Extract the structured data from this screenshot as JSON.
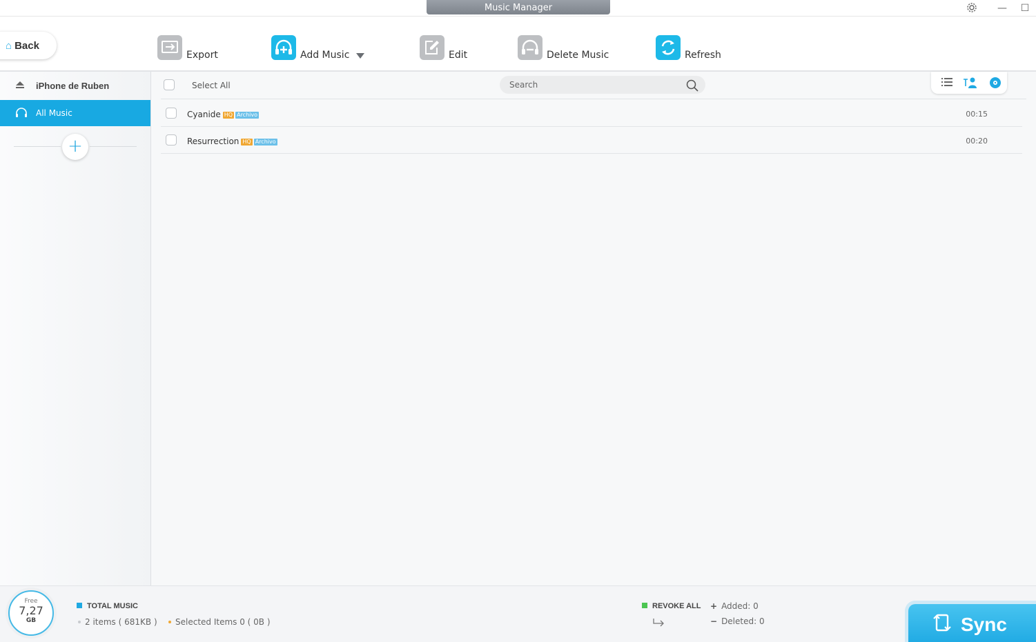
{
  "window": {
    "title": "Music Manager",
    "controls": {
      "settings_icon": "gear-icon",
      "minimize": "—",
      "maximize": "☐"
    }
  },
  "toolbar": {
    "back_label": "Back",
    "export_label": "Export",
    "add_music_label": "Add Music",
    "edit_label": "Edit",
    "delete_label": "Delete Music",
    "refresh_label": "Refresh"
  },
  "sidebar": {
    "device_name": "iPhone de Ruben",
    "selected_item": "All Music",
    "add_symbol": "+"
  },
  "list": {
    "select_all_label": "Select All",
    "search_placeholder": "Search",
    "tracks": [
      {
        "title": "Cyanide",
        "badge_quality": "HQ",
        "badge_type": "Archivo",
        "duration": "00:15"
      },
      {
        "title": "Resurrection",
        "badge_quality": "HQ",
        "badge_type": "Archivo",
        "duration": "00:20"
      }
    ]
  },
  "footer": {
    "storage_free_label": "Free",
    "storage_free_value": "7,27",
    "storage_unit": "GB",
    "total_label": "TOTAL MUSIC",
    "items_text": "2 items ( 681KB )",
    "selected_text": "Selected Items 0 ( 0B )",
    "revoke_label": "REVOKE ALL",
    "added_text": "Added: 0",
    "deleted_text": "Deleted: 0",
    "sync_label": "Sync"
  },
  "colors": {
    "accent": "#18a9e2",
    "hq_badge": "#f0a732",
    "archivo_badge": "#6cc0e9",
    "revoke_square": "#4cc552"
  }
}
